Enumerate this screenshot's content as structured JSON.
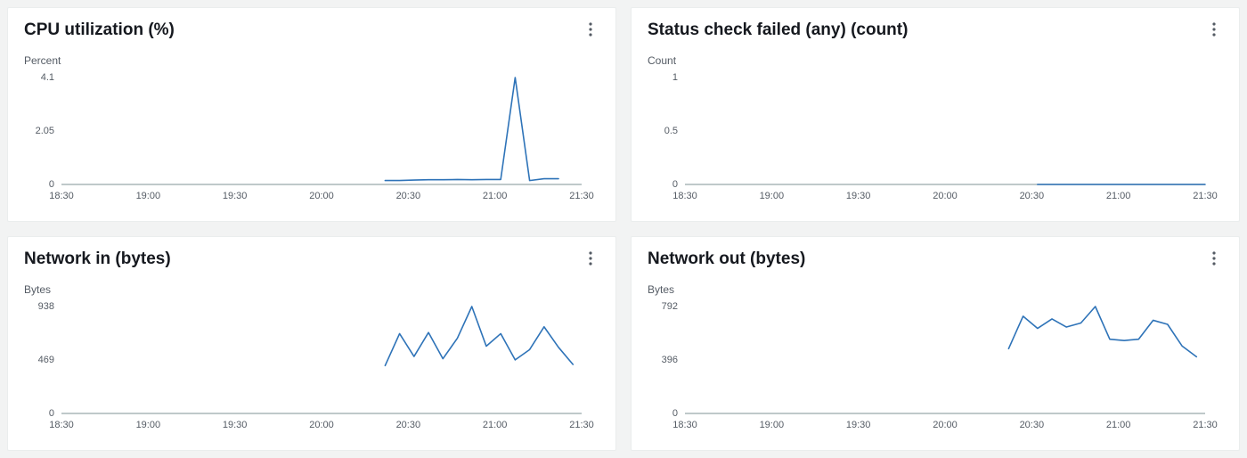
{
  "time": {
    "ticks": [
      "18:30",
      "19:00",
      "19:30",
      "20:00",
      "20:30",
      "21:00",
      "21:30"
    ],
    "ticks_minutes": [
      1110,
      1140,
      1170,
      1200,
      1230,
      1260,
      1290
    ],
    "range": [
      1110,
      1290
    ]
  },
  "panels": [
    {
      "id": "cpu",
      "title": "CPU utilization (%)",
      "ylabel": "Percent",
      "yticks": [
        "0",
        "2.05",
        "4.1"
      ],
      "ytick_vals": [
        0,
        2.05,
        4.1
      ],
      "ymax": 4.1
    },
    {
      "id": "status",
      "title": "Status check failed (any) (count)",
      "ylabel": "Count",
      "yticks": [
        "0",
        "0.5",
        "1"
      ],
      "ytick_vals": [
        0,
        0.5,
        1
      ],
      "ymax": 1
    },
    {
      "id": "netin",
      "title": "Network in (bytes)",
      "ylabel": "Bytes",
      "yticks": [
        "0",
        "469",
        "938"
      ],
      "ytick_vals": [
        0,
        469,
        938
      ],
      "ymax": 938
    },
    {
      "id": "netout",
      "title": "Network out (bytes)",
      "ylabel": "Bytes",
      "yticks": [
        "0",
        "396",
        "792"
      ],
      "ytick_vals": [
        0,
        396,
        792
      ],
      "ymax": 792
    }
  ],
  "chart_data": [
    {
      "id": "cpu",
      "type": "line",
      "title": "CPU utilization (%)",
      "xlabel": "",
      "ylabel": "Percent",
      "xlim": [
        1110,
        1290
      ],
      "ylim": [
        0,
        4.1
      ],
      "x_minutes": [
        1222,
        1227,
        1232,
        1237,
        1242,
        1247,
        1252,
        1257,
        1262,
        1267,
        1272,
        1277,
        1282
      ],
      "values": [
        0.15,
        0.15,
        0.17,
        0.18,
        0.18,
        0.19,
        0.18,
        0.19,
        0.19,
        4.1,
        0.15,
        0.22,
        0.22
      ]
    },
    {
      "id": "status",
      "type": "line",
      "title": "Status check failed (any) (count)",
      "xlabel": "",
      "ylabel": "Count",
      "xlim": [
        1110,
        1290
      ],
      "ylim": [
        0,
        1
      ],
      "x_minutes": [
        1232,
        1290
      ],
      "values": [
        0,
        0
      ]
    },
    {
      "id": "netin",
      "type": "line",
      "title": "Network in (bytes)",
      "xlabel": "",
      "ylabel": "Bytes",
      "xlim": [
        1110,
        1290
      ],
      "ylim": [
        0,
        938
      ],
      "x_minutes": [
        1222,
        1227,
        1232,
        1237,
        1242,
        1247,
        1252,
        1257,
        1262,
        1267,
        1272,
        1277,
        1282,
        1287
      ],
      "values": [
        420,
        700,
        500,
        710,
        480,
        660,
        938,
        590,
        700,
        470,
        560,
        760,
        580,
        430
      ]
    },
    {
      "id": "netout",
      "type": "line",
      "title": "Network out (bytes)",
      "xlabel": "",
      "ylabel": "Bytes",
      "xlim": [
        1110,
        1290
      ],
      "ylim": [
        0,
        792
      ],
      "x_minutes": [
        1222,
        1227,
        1232,
        1237,
        1242,
        1247,
        1252,
        1257,
        1262,
        1267,
        1272,
        1277,
        1282,
        1287
      ],
      "values": [
        480,
        720,
        630,
        700,
        640,
        670,
        792,
        550,
        540,
        550,
        690,
        660,
        500,
        420
      ]
    }
  ]
}
